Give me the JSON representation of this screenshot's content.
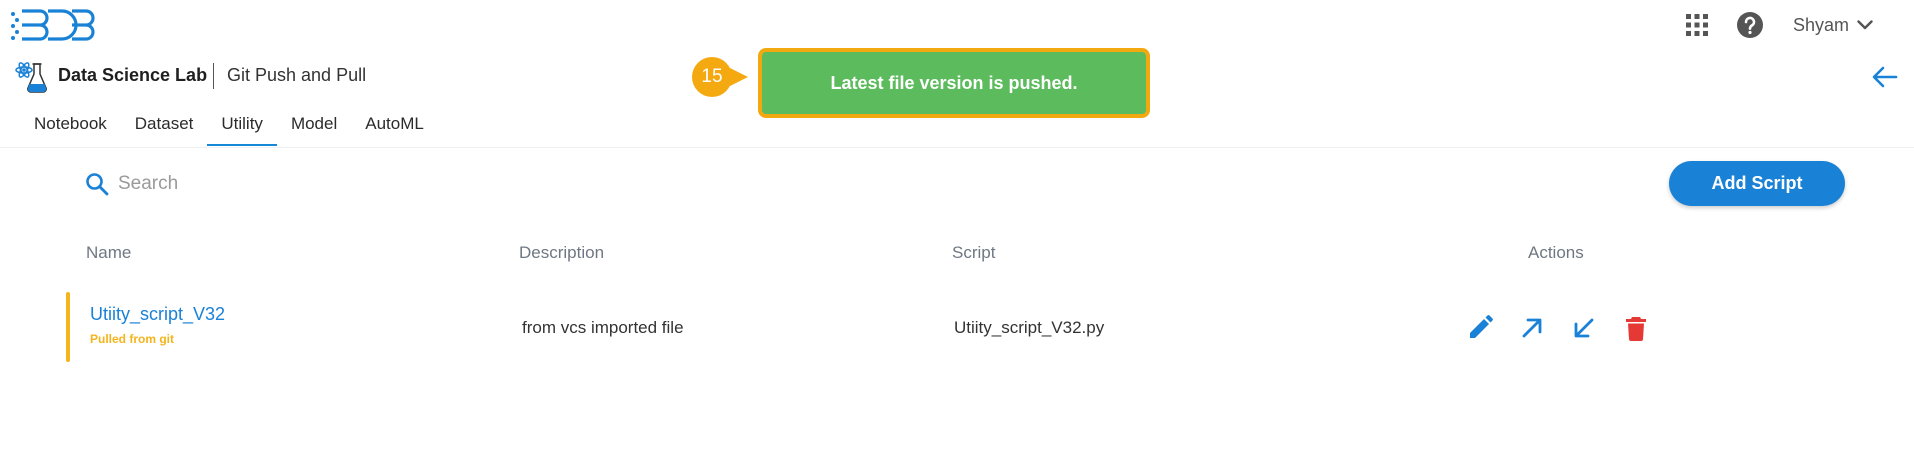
{
  "header": {
    "logo_icon": "bdb-logo",
    "apps_icon": "grid-apps-icon",
    "help_icon": "help-circle-icon",
    "user_name": "Shyam",
    "user_menu_icon": "chevron-down-icon"
  },
  "module": {
    "icon": "data-science-lab-icon",
    "title": "Data Science Lab",
    "page_title": "Git Push and Pull",
    "back_icon": "arrow-left-icon"
  },
  "tabs": [
    {
      "label": "Notebook",
      "active": false
    },
    {
      "label": "Dataset",
      "active": false
    },
    {
      "label": "Utility",
      "active": true
    },
    {
      "label": "Model",
      "active": false
    },
    {
      "label": "AutoML",
      "active": false
    }
  ],
  "toast": {
    "message": "Latest file version is pushed.",
    "color": "#5cbb5c",
    "border_color": "#f2a90f"
  },
  "step_badge": {
    "number": "15",
    "color": "#f4a911"
  },
  "search": {
    "placeholder": "Search",
    "value": ""
  },
  "add_button_label": "Add Script",
  "table": {
    "columns": [
      "Name",
      "Description",
      "Script",
      "Actions"
    ],
    "rows": [
      {
        "name": "Utiity_script_V32",
        "status": "Pulled from git",
        "description": "from vcs imported file",
        "script": "Utiity_script_V32.py",
        "actions": [
          "edit-icon",
          "push-icon",
          "pull-icon",
          "delete-icon"
        ]
      }
    ]
  },
  "colors": {
    "accent": "#1a82d6",
    "tab_underline": "#1589d7",
    "status": "#f4b41b",
    "delete": "#e53935"
  }
}
